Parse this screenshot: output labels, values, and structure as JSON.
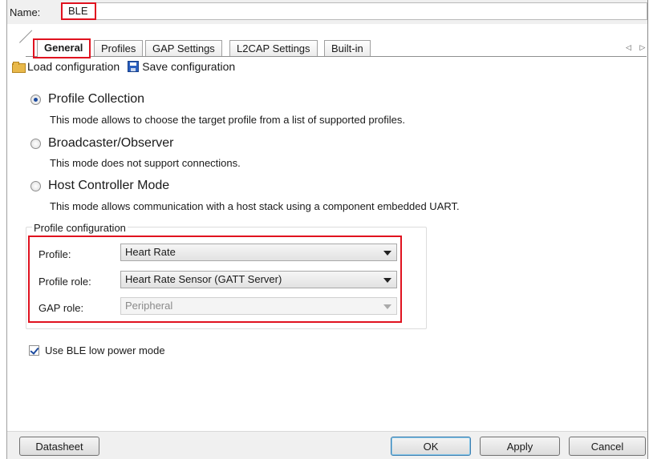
{
  "name_field": {
    "label": "Name:",
    "value": "BLE"
  },
  "tabs": [
    {
      "label": "General",
      "active": true
    },
    {
      "label": "Profiles",
      "active": false
    },
    {
      "label": "GAP Settings",
      "active": false
    },
    {
      "label": "L2CAP Settings",
      "active": false
    },
    {
      "label": "Built-in",
      "active": false
    }
  ],
  "tab_scroll_arrows": "◁ ▷",
  "toolbar": {
    "load_label": "Load configuration",
    "save_label": "Save configuration"
  },
  "modes": [
    {
      "label": "Profile Collection",
      "description": "This mode allows to choose the target profile from a list of supported profiles.",
      "selected": true
    },
    {
      "label": "Broadcaster/Observer",
      "description": "This mode does not support connections.",
      "selected": false
    },
    {
      "label": "Host Controller Mode",
      "description": "This mode allows communication with a host stack using a component embedded UART.",
      "selected": false
    }
  ],
  "profile_config": {
    "title": "Profile configuration",
    "profile_label": "Profile:",
    "profile_value": "Heart Rate",
    "role_label": "Profile role:",
    "role_value": "Heart Rate Sensor (GATT Server)",
    "gap_label": "GAP role:",
    "gap_value": "Peripheral"
  },
  "low_power": {
    "label": "Use BLE low power mode",
    "checked": true
  },
  "buttons": {
    "datasheet": "Datasheet",
    "ok": "OK",
    "apply": "Apply",
    "cancel": "Cancel"
  },
  "colors": {
    "highlight": "#e0121f",
    "radio_dot": "#1c4a9e"
  }
}
